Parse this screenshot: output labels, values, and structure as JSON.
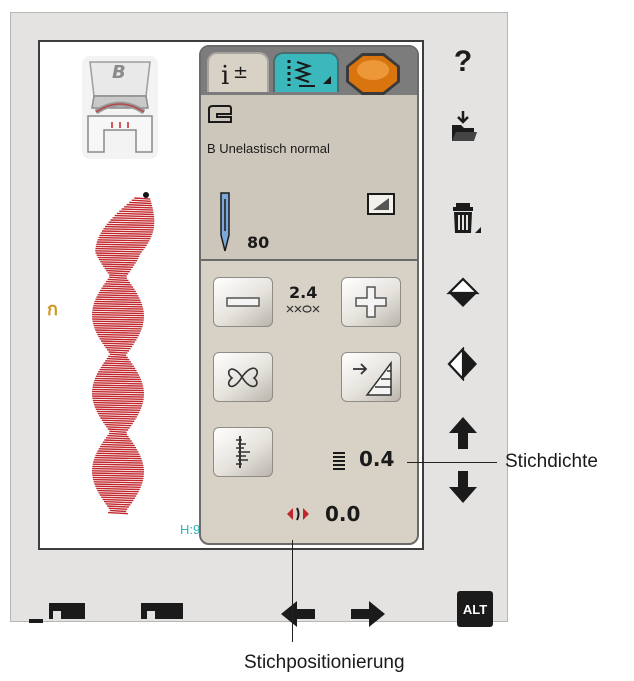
{
  "foot": {
    "letter": "B"
  },
  "stitch_panel": {
    "height_label": "H:9"
  },
  "settings": {
    "fabric_label": "B Unelastisch normal",
    "needle_size": "80",
    "stitch_width": "2.4",
    "stitch_density": "0.4",
    "stitch_position": "0.0"
  },
  "side_toolbar": {
    "help_label": "?"
  },
  "bottom_toolbar": {
    "alt_label": "ALT"
  },
  "callouts": {
    "density": "Stichdichte",
    "position": "Stichpositionierung"
  },
  "icons": [
    "presser-foot-icon",
    "needle-icon",
    "info-tab-icon",
    "stitch-tab-icon",
    "spool-tab-icon",
    "sewing-machine-icon",
    "mirror-icon",
    "hoop-icon",
    "minus-icon",
    "plus-icon",
    "tie-off-icon",
    "taper-icon",
    "density-icon",
    "position-icon",
    "help-icon",
    "load-icon",
    "delete-icon",
    "mirror-vertical-icon",
    "mirror-horizontal-icon",
    "arrow-up-icon",
    "arrow-down-icon",
    "arrow-left-icon",
    "arrow-right-icon",
    "start-of-pattern-icon",
    "stitch-restart-icon",
    "alt-icon"
  ],
  "colors": {
    "accent": "#3bb8bc",
    "stitch": "#c0262c",
    "panel": "#d8d2c6"
  }
}
